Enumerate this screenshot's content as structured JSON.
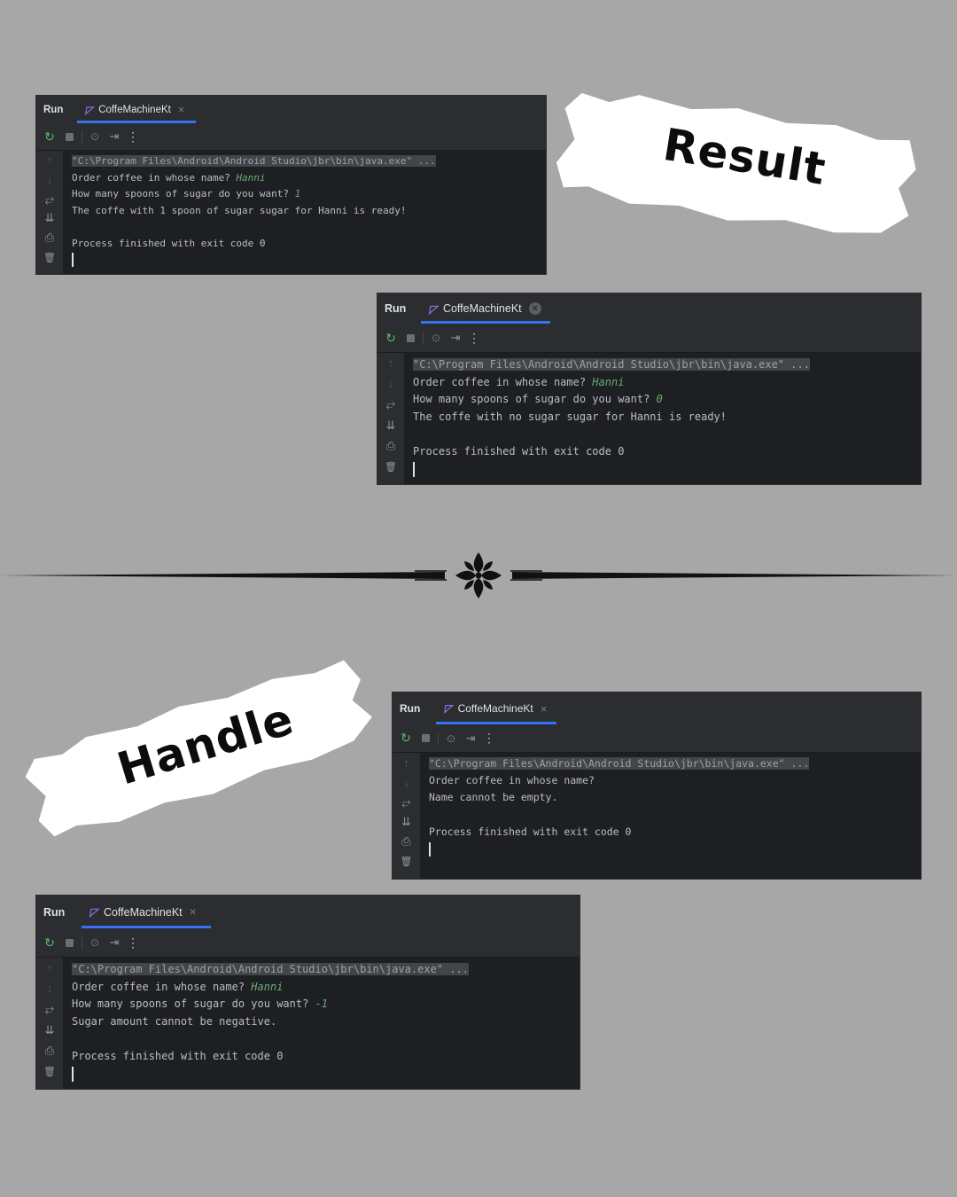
{
  "labels": {
    "result": "Result",
    "handle": "Handle"
  },
  "panels": [
    {
      "run_label": "Run",
      "tab_label": "CoffeMachineKt",
      "tab_close": "×",
      "lines": [
        {
          "kind": "cmd",
          "text": "\"C:\\Program Files\\Android\\Android Studio\\jbr\\bin\\java.exe\" ..."
        },
        {
          "kind": "prompt",
          "text": "Order coffee in whose name? ",
          "input": "Hanni"
        },
        {
          "kind": "prompt",
          "text": "How many spoons of sugar do you want? ",
          "input": "1"
        },
        {
          "kind": "text",
          "text": "The coffe with 1 spoon of sugar sugar for Hanni is ready!"
        },
        {
          "kind": "text",
          "text": ""
        },
        {
          "kind": "text",
          "text": "Process finished with exit code 0"
        }
      ]
    },
    {
      "run_label": "Run",
      "tab_label": "CoffeMachineKt",
      "tab_close": "×",
      "lines": [
        {
          "kind": "cmd",
          "text": "\"C:\\Program Files\\Android\\Android Studio\\jbr\\bin\\java.exe\" ..."
        },
        {
          "kind": "prompt",
          "text": "Order coffee in whose name? ",
          "input": "Hanni"
        },
        {
          "kind": "prompt",
          "text": "How many spoons of sugar do you want? ",
          "input": "0"
        },
        {
          "kind": "text",
          "text": "The coffe with no sugar sugar for Hanni is ready!"
        },
        {
          "kind": "text",
          "text": ""
        },
        {
          "kind": "text",
          "text": "Process finished with exit code 0"
        }
      ]
    },
    {
      "run_label": "Run",
      "tab_label": "CoffeMachineKt",
      "tab_close": "×",
      "lines": [
        {
          "kind": "cmd",
          "text": "\"C:\\Program Files\\Android\\Android Studio\\jbr\\bin\\java.exe\" ..."
        },
        {
          "kind": "text",
          "text": "Order coffee in whose name?"
        },
        {
          "kind": "text",
          "text": "Name cannot be empty."
        },
        {
          "kind": "text",
          "text": ""
        },
        {
          "kind": "text",
          "text": "Process finished with exit code 0"
        }
      ]
    },
    {
      "run_label": "Run",
      "tab_label": "CoffeMachineKt",
      "tab_close": "×",
      "lines": [
        {
          "kind": "cmd",
          "text": "\"C:\\Program Files\\Android\\Android Studio\\jbr\\bin\\java.exe\" ..."
        },
        {
          "kind": "prompt",
          "text": "Order coffee in whose name? ",
          "input": "Hanni"
        },
        {
          "kind": "prompt",
          "text": "How many spoons of sugar do you want? ",
          "input": "-1"
        },
        {
          "kind": "text",
          "text": "Sugar amount cannot be negative."
        },
        {
          "kind": "text",
          "text": ""
        },
        {
          "kind": "text",
          "text": "Process finished with exit code 0"
        }
      ]
    }
  ],
  "icons": {
    "rerun": "rerun-icon",
    "stop": "stop-icon",
    "camera": "screenshot-icon",
    "exit": "exit-icon",
    "more": "more-vertical-icon",
    "up": "arrow-up-icon",
    "down": "arrow-down-icon",
    "wrap": "soft-wrap-icon",
    "scroll": "scroll-to-end-icon",
    "print": "print-icon",
    "trash": "trash-icon",
    "ornament": "fleur-ornament-icon"
  },
  "colors": {
    "background": "#a7a7a7",
    "panel": "#1e1f22",
    "chrome": "#2b2d30",
    "text": "#bcbec4",
    "input": "#6aab73",
    "accent": "#3574f0",
    "kotlin": "#8a73e6"
  }
}
